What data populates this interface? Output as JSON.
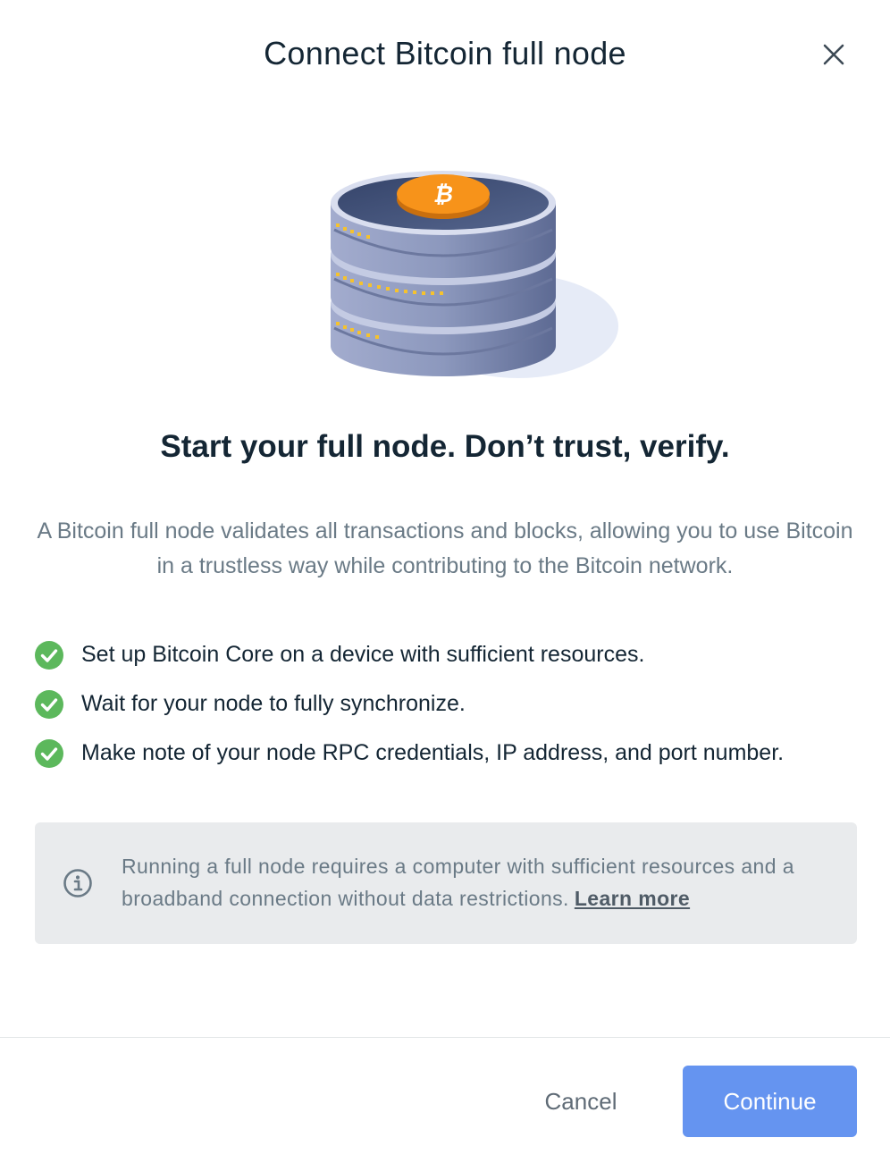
{
  "dialog": {
    "title": "Connect Bitcoin full node",
    "close_icon": "close-icon"
  },
  "illustration": {
    "icon": "bitcoin-node-stack-icon",
    "coin_symbol": "bitcoin-icon",
    "colors": {
      "coin": "#f7931a",
      "disk_top": "#3f4f73",
      "disk_side": "#8f9bc0",
      "led": "#f5c22e"
    }
  },
  "content": {
    "headline": "Start your full node. Don’t trust, verify.",
    "description": "A Bitcoin full node validates all transactions and blocks, allowing you to use Bitcoin in a trustless way while contributing to the Bitcoin network.",
    "checklist": [
      {
        "text": "Set up Bitcoin Core on a device with sufficient resources.",
        "icon": "check-circle-icon"
      },
      {
        "text": "Wait for your node to fully synchronize.",
        "icon": "check-circle-icon"
      },
      {
        "text": "Make note of your node RPC credentials, IP address, and port number.",
        "icon": "check-circle-icon"
      }
    ]
  },
  "info": {
    "icon": "info-icon",
    "text": "Running a full node requires a computer with sufficient resources and a broadband connection without data restrictions.",
    "link_label": "Learn more"
  },
  "footer": {
    "cancel_label": "Cancel",
    "continue_label": "Continue"
  },
  "colors": {
    "accent": "#6594f0",
    "success": "#5cb85c",
    "text_primary": "#142634",
    "text_secondary": "#6a7a86",
    "info_bg": "#e9ebed"
  }
}
